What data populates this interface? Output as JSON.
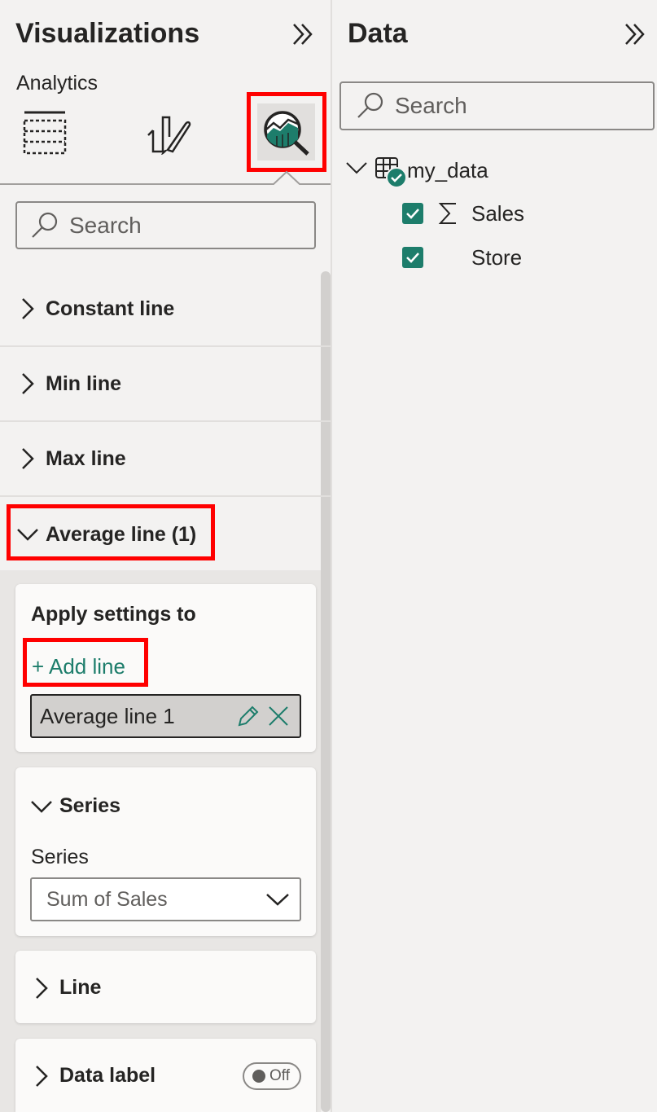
{
  "visualizations": {
    "title": "Visualizations",
    "analytics_label": "Analytics",
    "search_placeholder": "Search",
    "sections": {
      "constant_line": "Constant line",
      "min_line": "Min line",
      "max_line": "Max line",
      "average_line": "Average line (1)"
    },
    "apply_card": {
      "title": "Apply settings to",
      "add_line": "+ Add line",
      "selected_line": "Average line 1"
    },
    "series_card": {
      "header": "Series",
      "field_label": "Series",
      "dropdown_value": "Sum of Sales"
    },
    "line_card": {
      "header": "Line"
    },
    "data_label_card": {
      "header": "Data label",
      "toggle": "Off"
    }
  },
  "data_pane": {
    "title": "Data",
    "search_placeholder": "Search",
    "table": {
      "name": "my_data",
      "fields": [
        {
          "name": "Sales",
          "checked": true,
          "icon": "sigma-icon"
        },
        {
          "name": "Store",
          "checked": true,
          "icon": ""
        }
      ]
    }
  },
  "colors": {
    "accent": "#1d7d6b",
    "highlight": "#ff0000",
    "background": "#f3f2f1"
  }
}
